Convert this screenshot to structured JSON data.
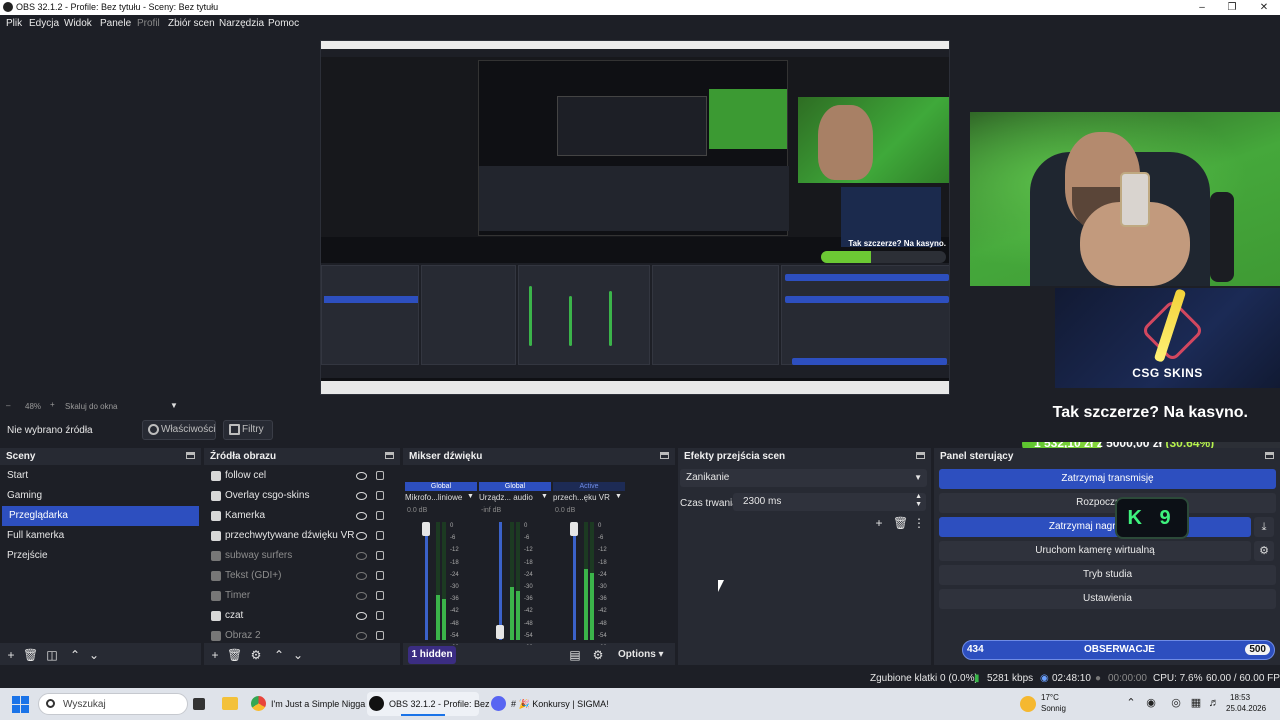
{
  "window": {
    "title": "OBS 32.1.2 - Profile: Bez tytułu - Sceny: Bez tytułu"
  },
  "menu": [
    "Plik",
    "Edycja",
    "Widok",
    "Panele",
    "Profil",
    "Zbiór scen",
    "Narzędzia",
    "Pomoc"
  ],
  "preview": {
    "zoom": "48%",
    "fit_label": "Skaluj do okna",
    "overlay": {
      "brand": "CSG SKINS",
      "question": "Tak szczerze? Na kasyno.",
      "goal_current": "1 532,10 zł",
      "goal_of": "z",
      "goal_target": "5000,00 zł",
      "goal_percent": "(30.64%)",
      "goal_fraction": 0.3064
    }
  },
  "source_toolbar": {
    "no_source": "Nie wybrano źródła",
    "properties": "Właściwości",
    "filters": "Filtry"
  },
  "scenes": {
    "title": "Sceny",
    "items": [
      "Start",
      "Gaming",
      "Przeglądarka",
      "Full kamerka",
      "Przejście"
    ],
    "selected_index": 2
  },
  "sources": {
    "title": "Źródła obrazu",
    "items": [
      {
        "label": "follow cel",
        "dim": false
      },
      {
        "label": "Overlay csgo-skins",
        "dim": false
      },
      {
        "label": "Kamerka",
        "dim": false
      },
      {
        "label": "przechwytywane dźwięku VR",
        "dim": false
      },
      {
        "label": "subway surfers",
        "dim": true
      },
      {
        "label": "Tekst (GDI+)",
        "dim": true
      },
      {
        "label": "Timer",
        "dim": true
      },
      {
        "label": "czat",
        "dim": false
      },
      {
        "label": "Obraz 2",
        "dim": true
      }
    ]
  },
  "mixer": {
    "title": "Mikser dźwięku",
    "channels": [
      {
        "badge": "Global",
        "name": "Mikrofo...liniowe",
        "db": "0.0 dB",
        "level": 0.38
      },
      {
        "badge": "Global",
        "name": "Urządz... audio",
        "db": "-inf dB",
        "level": 0.45
      },
      {
        "badge": "Active",
        "name": "przech...ęku VR",
        "db": "0.0 dB",
        "level": 0.6
      }
    ],
    "scale": [
      "0",
      "-6",
      "-12",
      "-18",
      "-24",
      "-30",
      "-36",
      "-42",
      "-48",
      "-54",
      "-60"
    ],
    "hidden_label": "1 hidden",
    "options_label": "Options"
  },
  "transitions": {
    "title": "Efekty przejścia scen",
    "selected": "Zanikanie",
    "duration_label": "Czas trwania",
    "duration_value": "2300 ms"
  },
  "controls": {
    "title": "Panel sterujący",
    "stop_stream": "Zatrzymaj transmisję",
    "start_record": "Rozpocznij na",
    "stop_record": "Zatrzymaj nagrywani",
    "virtual_cam": "Uruchom kamerę wirtualną",
    "studio": "Tryb studia",
    "settings": "Ustawienia"
  },
  "overlay_k9": "K 9",
  "follow_bar": {
    "current": "434",
    "label": "OBSERWACJE",
    "target": "500",
    "fraction": 0.868
  },
  "status": {
    "dropped": "Zgubione klatki 0 (0.0%)",
    "bitrate": "5281 kbps",
    "live_time": "02:48:10",
    "rec_time": "00:00:00",
    "cpu": "CPU: 7.6%",
    "fps": "60.00 / 60.00 FPS"
  },
  "taskbar": {
    "search": "Wyszukaj",
    "apps": [
      {
        "label": "I'm Just a Simple Nigga",
        "color": "#e8453c"
      },
      {
        "label": "OBS 32.1.2 - Profile: Bez",
        "color": "#111111",
        "active": true
      },
      {
        "label": "# 🎉 Konkursy | SIGMA!",
        "color": "#5865f2"
      }
    ],
    "weather_temp": "17°C",
    "weather_desc": "Sonnig",
    "time": "18:53",
    "date": "25.04.2026"
  }
}
